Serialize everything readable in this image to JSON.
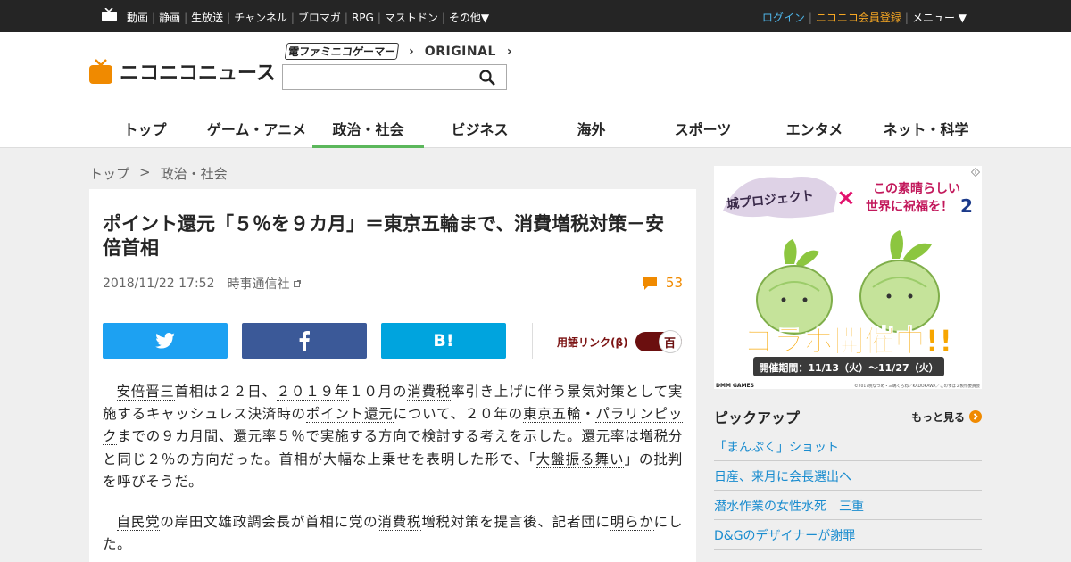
{
  "topbar": {
    "nav": [
      "動画",
      "静画",
      "生放送",
      "チャンネル",
      "ブロマガ",
      "RPG",
      "マストドン",
      "その他▼"
    ],
    "login": "ログイン",
    "register": "ニコニコ会員登録",
    "menu": "メニュー ▼"
  },
  "header": {
    "logo_text": "ニコニコニュース",
    "subnav": {
      "dengeki": "電ファミニコゲーマー",
      "original": "ORIGINAL"
    },
    "search": {
      "placeholder": "",
      "value": ""
    },
    "tabs": [
      {
        "label": "トップ",
        "active": false
      },
      {
        "label": "ゲーム・アニメ",
        "active": false
      },
      {
        "label": "政治・社会",
        "active": true
      },
      {
        "label": "ビジネス",
        "active": false
      },
      {
        "label": "海外",
        "active": false
      },
      {
        "label": "スポーツ",
        "active": false
      },
      {
        "label": "エンタメ",
        "active": false
      },
      {
        "label": "ネット・科学",
        "active": false
      }
    ],
    "accent_color": "#5bb75b"
  },
  "breadcrumb": {
    "home": "トップ",
    "separator": ">",
    "current": "政治・社会"
  },
  "article": {
    "title": "ポイント還元「５％を９カ月」＝東京五輪まで、消費増税対策－安倍首相",
    "date": "2018/11/22 17:52",
    "source": "時事通信社",
    "comment_count": "53",
    "share": {
      "hatena": "B!"
    },
    "term_link_label": "用語リンク(β)",
    "term_toggle_char": "百",
    "p1": [
      {
        "t": "安倍晋三",
        "kw": true
      },
      {
        "t": "首相は２２日、",
        "kw": false
      },
      {
        "t": "２０１９年",
        "kw": true
      },
      {
        "t": "１０月の",
        "kw": false
      },
      {
        "t": "消費税",
        "kw": true
      },
      {
        "t": "率引き上げに伴う景気対策として実施するキャッシュレス決済時の",
        "kw": false
      },
      {
        "t": "ポイント還元",
        "kw": true
      },
      {
        "t": "について、２０年の",
        "kw": false
      },
      {
        "t": "東京五輪",
        "kw": true
      },
      {
        "t": "・",
        "kw": false
      },
      {
        "t": "パラリンピック",
        "kw": true
      },
      {
        "t": "までの９カ月間、還元率５％で実施する方向で検討する考えを示した。還元率は増税分と同じ２％の方向だった。首相が大幅な上乗せを表明した形で、「",
        "kw": false
      },
      {
        "t": "大盤振る舞い",
        "kw": true
      },
      {
        "t": "」の批判を呼びそうだ。",
        "kw": false
      }
    ],
    "p2": [
      {
        "t": "自民党",
        "kw": true
      },
      {
        "t": "の岸田文雄政調会長が首相に党の",
        "kw": false
      },
      {
        "t": "消費税",
        "kw": true
      },
      {
        "t": "増税対策を提言後、記者団に",
        "kw": false
      },
      {
        "t": "明らか",
        "kw": true
      },
      {
        "t": "にした。",
        "kw": false
      }
    ]
  },
  "sidebar": {
    "ad": {
      "left_logo": "城プロジェクト",
      "cross": "×",
      "right_title_1": "この素晴らしい",
      "right_title_2": "世界に祝福を！",
      "right_num": "2",
      "headline": "コラボ開催中!!",
      "period": "開催期間：11/13（火）～11/27（火）",
      "brand": "DMM GAMES",
      "copyright": "©2017暁なつめ・三嶋くろね／KADOKAWA／このすば２製作委員会"
    },
    "pickup": {
      "title": "ピックアップ",
      "more": "もっと見る",
      "items": [
        "「まんぷく」ショット",
        "日産、来月に会長選出へ",
        "潜水作業の女性水死　三重",
        "D&Gのデザイナーが謝罪"
      ]
    }
  }
}
